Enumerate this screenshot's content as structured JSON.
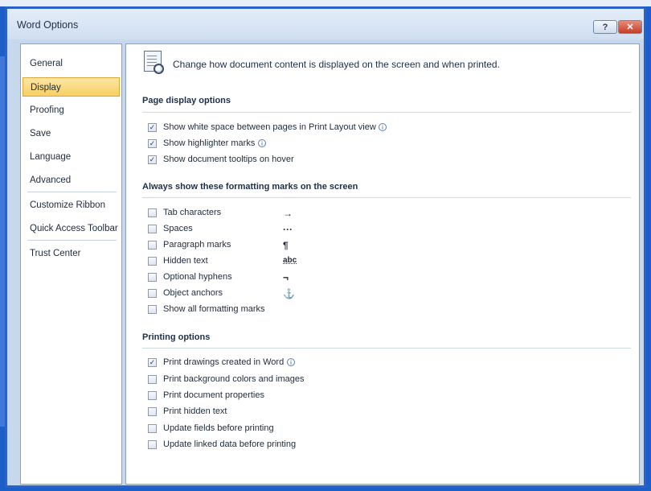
{
  "window": {
    "title": "Word Options",
    "help_symbol": "?",
    "close_symbol": "✕"
  },
  "sidebar": {
    "items": [
      {
        "label": "General"
      },
      {
        "label": "Display"
      },
      {
        "label": "Proofing"
      },
      {
        "label": "Save"
      },
      {
        "label": "Language"
      },
      {
        "label": "Advanced"
      },
      {
        "label": "Customize Ribbon"
      },
      {
        "label": "Quick Access Toolbar"
      },
      {
        "label": "Trust Center"
      }
    ],
    "selected": "Display"
  },
  "header": {
    "intro": "Change how document content is displayed on the screen and when printed."
  },
  "page_display": {
    "title": "Page display options",
    "options": [
      {
        "label": "Show white space between pages in Print Layout view",
        "checked": true,
        "info": true
      },
      {
        "label": "Show highlighter marks",
        "checked": true,
        "info": true
      },
      {
        "label": "Show document tooltips on hover",
        "checked": true,
        "info": false
      }
    ]
  },
  "formatting_marks": {
    "title": "Always show these formatting marks on the screen",
    "options": [
      {
        "label": "Tab characters",
        "checked": false,
        "mark": "→"
      },
      {
        "label": "Spaces",
        "checked": false,
        "mark": "···"
      },
      {
        "label": "Paragraph marks",
        "checked": false,
        "mark": "¶"
      },
      {
        "label": "Hidden text",
        "checked": false,
        "mark": "abc"
      },
      {
        "label": "Optional hyphens",
        "checked": false,
        "mark": "¬"
      },
      {
        "label": "Object anchors",
        "checked": false,
        "mark": "⚓"
      },
      {
        "label": "Show all formatting marks",
        "checked": false,
        "mark": ""
      }
    ]
  },
  "printing": {
    "title": "Printing options",
    "options": [
      {
        "label": "Print drawings created in Word",
        "checked": true,
        "info": true
      },
      {
        "label": "Print background colors and images",
        "checked": false
      },
      {
        "label": "Print document properties",
        "checked": false
      },
      {
        "label": "Print hidden text",
        "checked": false
      },
      {
        "label": "Update fields before printing",
        "checked": false
      },
      {
        "label": "Update linked data before printing",
        "checked": false
      }
    ]
  },
  "colors": {
    "frame": "#2a62c9",
    "selected_bg": "#f7cf62",
    "panel": "#ffffff"
  }
}
